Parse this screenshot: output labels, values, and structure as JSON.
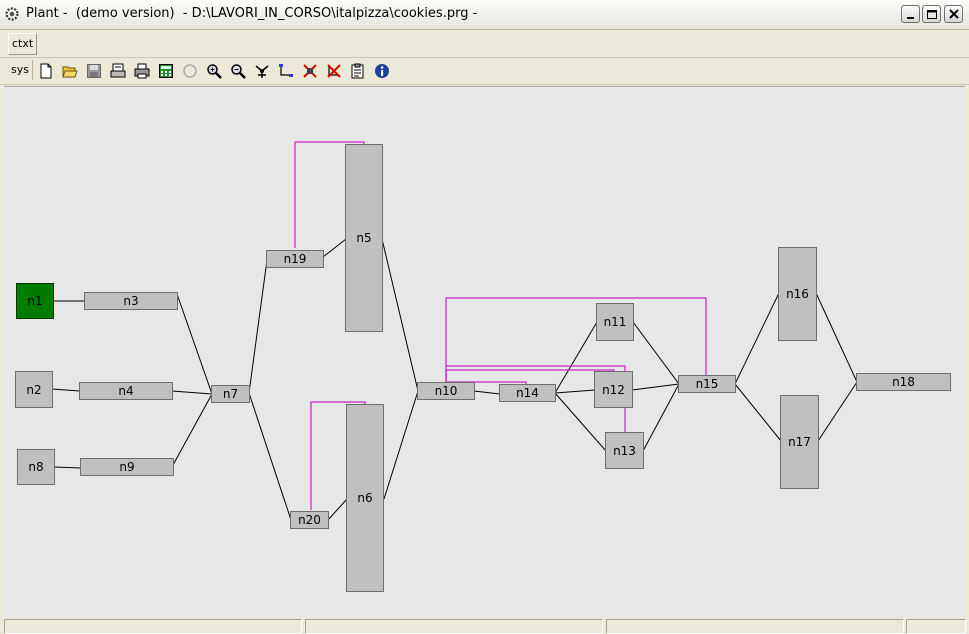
{
  "window": {
    "title": "Plant -  (demo version)  - D:\\LAVORI_IN_CORSO\\italpizza\\cookies.prg -",
    "buttons": [
      "minimize",
      "maximize",
      "close"
    ]
  },
  "context_bar": {
    "label": "ctxt"
  },
  "toolbar": {
    "label": "sys",
    "icons": [
      "new-file-icon",
      "open-folder-icon",
      "save-icon",
      "print-preview-icon",
      "print-icon",
      "calculator-icon",
      "circle-icon",
      "zoom-in-icon",
      "zoom-out-icon",
      "pan-icon",
      "connect-icon",
      "delete-node-icon",
      "delete-link-icon",
      "properties-icon",
      "info-icon"
    ]
  },
  "nodes": {
    "n1": "n1",
    "n2": "n2",
    "n3": "n3",
    "n4": "n4",
    "n5": "n5",
    "n6": "n6",
    "n7": "n7",
    "n8": "n8",
    "n9": "n9",
    "n10": "n10",
    "n11": "n11",
    "n12": "n12",
    "n13": "n13",
    "n14": "n14",
    "n15": "n15",
    "n16": "n16",
    "n17": "n17",
    "n18": "n18",
    "n19": "n19",
    "n20": "n20"
  },
  "colors": {
    "canvas": "#e7e7e7",
    "node": "#c0c0c0",
    "active_node": "#007d00",
    "link": "#000000",
    "feedback_link": "#cc22cc"
  }
}
